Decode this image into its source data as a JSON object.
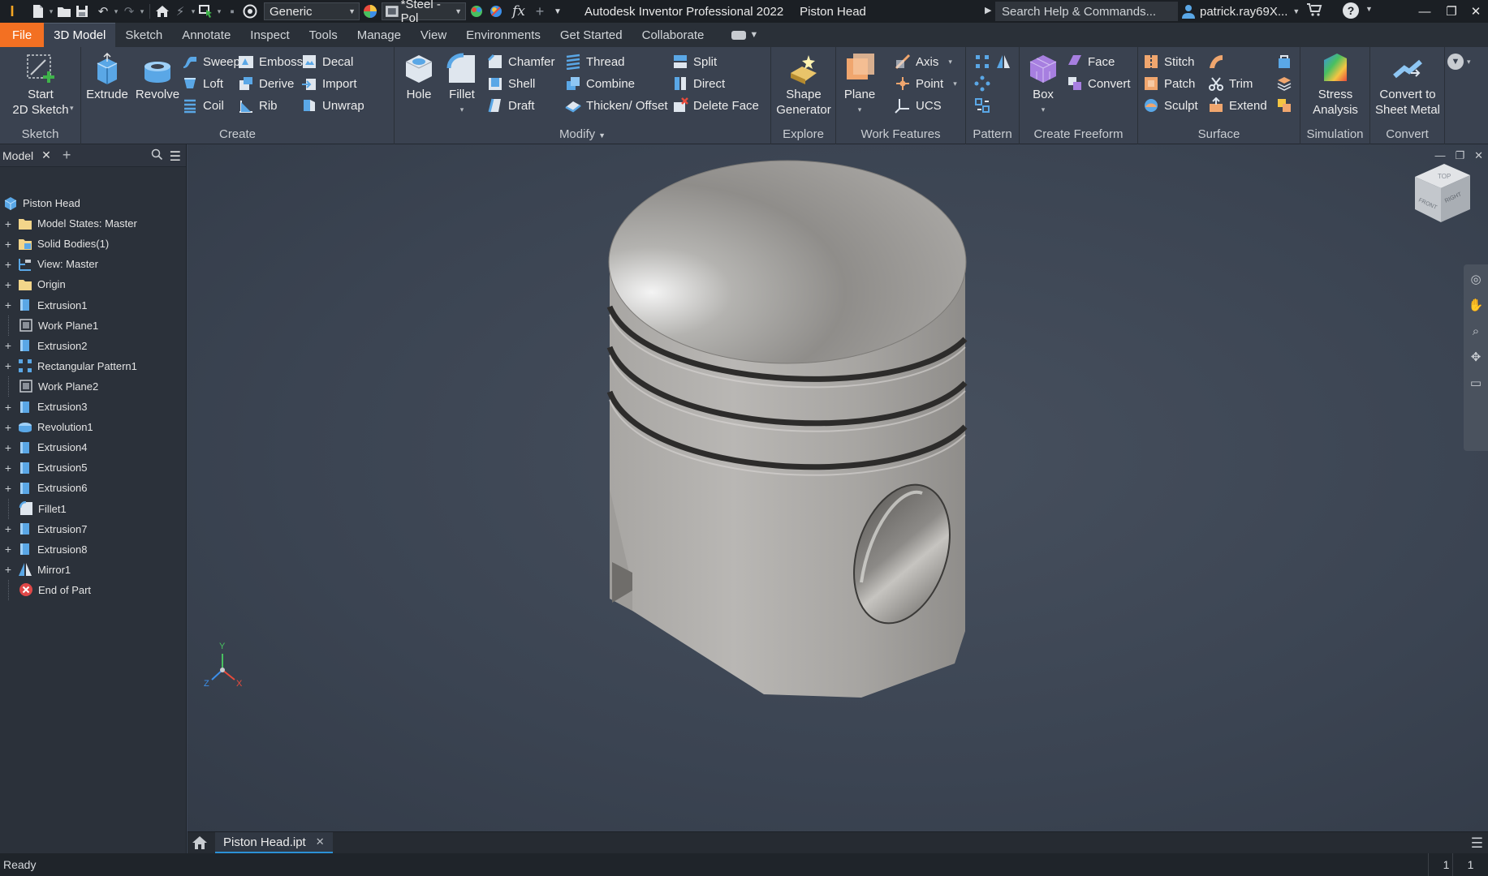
{
  "titlebar": {
    "material_style": "Generic",
    "material_value": "*Steel - Pol",
    "fx_label": "fx",
    "app_title": "Autodesk Inventor Professional 2022",
    "doc_title": "Piston Head",
    "search_placeholder": "Search Help & Commands...",
    "user_name": "patrick.ray69X...",
    "help_label": "?"
  },
  "tabs": [
    "File",
    "3D Model",
    "Sketch",
    "Annotate",
    "Inspect",
    "Tools",
    "Manage",
    "View",
    "Environments",
    "Get Started",
    "Collaborate"
  ],
  "ribbon": {
    "sketch": {
      "label": "Sketch",
      "start_2d_sketch": "Start\n2D Sketch"
    },
    "create": {
      "label": "Create",
      "extrude": "Extrude",
      "revolve": "Revolve",
      "sweep": "Sweep",
      "loft": "Loft",
      "coil": "Coil",
      "emboss": "Emboss",
      "derive": "Derive",
      "rib": "Rib",
      "decal": "Decal",
      "import": "Import",
      "unwrap": "Unwrap"
    },
    "modify": {
      "label": "Modify",
      "hole": "Hole",
      "fillet": "Fillet",
      "chamfer": "Chamfer",
      "shell": "Shell",
      "draft": "Draft",
      "thread": "Thread",
      "combine": "Combine",
      "thicken": "Thicken/ Offset",
      "split": "Split",
      "direct": "Direct",
      "delete_face": "Delete Face"
    },
    "explore": {
      "label": "Explore",
      "shape_generator": "Shape\nGenerator"
    },
    "work_features": {
      "label": "Work Features",
      "plane": "Plane",
      "axis": "Axis",
      "point": "Point",
      "ucs": "UCS"
    },
    "pattern": {
      "label": "Pattern"
    },
    "create_freeform": {
      "label": "Create Freeform",
      "box": "Box",
      "face": "Face",
      "convert": "Convert"
    },
    "surface": {
      "label": "Surface",
      "stitch": "Stitch",
      "patch": "Patch",
      "sculpt": "Sculpt",
      "trim": "Trim",
      "extend": "Extend"
    },
    "simulation": {
      "label": "Simulation",
      "stress_analysis": "Stress\nAnalysis"
    },
    "convert": {
      "label": "Convert",
      "convert_to_sheet_metal": "Convert to\nSheet Metal"
    }
  },
  "browser": {
    "tab_label": "Model",
    "items": [
      {
        "label": "Piston Head",
        "icon": "part-icon",
        "expand": false,
        "root": true
      },
      {
        "label": "Model States: Master",
        "icon": "folder-icon",
        "expand": true
      },
      {
        "label": "Solid Bodies(1)",
        "icon": "solid-bodies-icon",
        "expand": true
      },
      {
        "label": "View: Master",
        "icon": "view-icon",
        "expand": true
      },
      {
        "label": "Origin",
        "icon": "folder-icon",
        "expand": true
      },
      {
        "label": "Extrusion1",
        "icon": "extrusion-icon",
        "expand": true
      },
      {
        "label": "Work Plane1",
        "icon": "work-plane-icon",
        "expand": false
      },
      {
        "label": "Extrusion2",
        "icon": "extrusion-icon",
        "expand": true
      },
      {
        "label": "Rectangular Pattern1",
        "icon": "rectangular-pattern-icon",
        "expand": true
      },
      {
        "label": "Work Plane2",
        "icon": "work-plane-icon",
        "expand": false
      },
      {
        "label": "Extrusion3",
        "icon": "extrusion-icon",
        "expand": true
      },
      {
        "label": "Revolution1",
        "icon": "revolution-icon",
        "expand": true
      },
      {
        "label": "Extrusion4",
        "icon": "extrusion-icon",
        "expand": true
      },
      {
        "label": "Extrusion5",
        "icon": "extrusion-icon",
        "expand": true
      },
      {
        "label": "Extrusion6",
        "icon": "extrusion-icon",
        "expand": true
      },
      {
        "label": "Fillet1",
        "icon": "fillet-icon",
        "expand": false
      },
      {
        "label": "Extrusion7",
        "icon": "extrusion-icon",
        "expand": true
      },
      {
        "label": "Extrusion8",
        "icon": "extrusion-icon",
        "expand": true
      },
      {
        "label": "Mirror1",
        "icon": "mirror-icon",
        "expand": true
      },
      {
        "label": "End of Part",
        "icon": "end-of-part-icon",
        "expand": false
      }
    ]
  },
  "viewcube": {
    "top": "TOP",
    "front": "FRONT",
    "right": "RIGHT"
  },
  "axis_triad": {
    "x": "X",
    "y": "Y",
    "z": "Z"
  },
  "doc_tab": {
    "label": "Piston Head.ipt"
  },
  "status": {
    "text": "Ready",
    "count1": "1",
    "count2": "1"
  },
  "colors": {
    "file_tab": "#f37022",
    "accent_blue": "#2c91d6",
    "ribbon_bg": "#3a4250",
    "viewport_bg": "#3b4452"
  }
}
